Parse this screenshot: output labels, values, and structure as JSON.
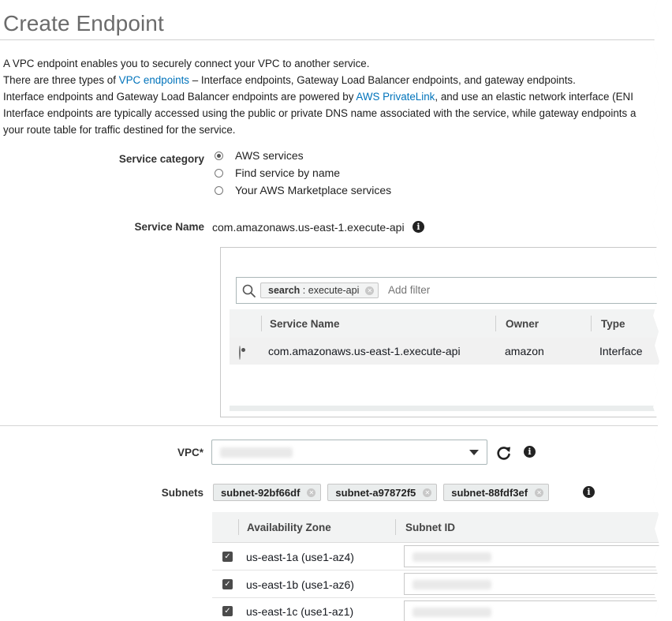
{
  "page": {
    "title": "Create Endpoint",
    "intro": {
      "line1": "A VPC endpoint enables you to securely connect your VPC to another service.",
      "line2_before": "There are three types of",
      "line2_link": "VPC endpoints",
      "line2_after": "– Interface endpoints, Gateway Load Balancer endpoints, and gateway endpoints.",
      "line3_before": "Interface endpoints and Gateway Load Balancer endpoints are powered by",
      "line3_link": "AWS PrivateLink",
      "line3_after": ", and use an elastic network interface (ENI",
      "line4": "Interface endpoints are typically accessed using the public or private DNS name associated with the service, while gateway endpoints a",
      "line5": "your route table for traffic destined for the service."
    }
  },
  "service_category": {
    "label": "Service category",
    "options": [
      {
        "label": "AWS services",
        "checked": true
      },
      {
        "label": "Find service by name",
        "checked": false
      },
      {
        "label": "Your AWS Marketplace services",
        "checked": false
      }
    ]
  },
  "service_name": {
    "label": "Service Name",
    "value": "com.amazonaws.us-east-1.execute-api"
  },
  "service_table": {
    "filter_tag_key": "search",
    "filter_tag_value": ": execute-api",
    "filter_placeholder": "Add filter",
    "columns": [
      "Service Name",
      "Owner",
      "Type"
    ],
    "rows": [
      {
        "service_name": "com.amazonaws.us-east-1.execute-api",
        "owner": "amazon",
        "type": "Interface",
        "selected": true
      }
    ]
  },
  "vpc": {
    "label": "VPC*"
  },
  "subnets": {
    "label": "Subnets",
    "tags": [
      "subnet-92bf66df",
      "subnet-a97872f5",
      "subnet-88fdf3ef"
    ],
    "columns": [
      "Availability Zone",
      "Subnet ID"
    ],
    "rows": [
      {
        "az": "us-east-1a (use1-az4)",
        "checked": true
      },
      {
        "az": "us-east-1b (use1-az6)",
        "checked": true
      },
      {
        "az": "us-east-1c (use1-az1)",
        "checked": true
      }
    ]
  },
  "colors": {
    "link": "#0073bb",
    "title": "#6b6b6b",
    "header_bg": "#f2f3f3"
  },
  "icons": [
    "info-icon",
    "search-icon",
    "refresh-icon",
    "dropdown-caret-icon",
    "close-icon",
    "checkbox-icon"
  ]
}
